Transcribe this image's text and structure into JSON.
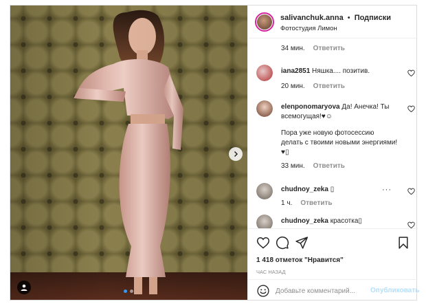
{
  "header": {
    "username": "salivanchuk.anna",
    "separator": "•",
    "follow_label": "Подписки",
    "location": "Фотостудия Лимон"
  },
  "comments": [
    {
      "meta_time": "34 мин.",
      "reply_label": "Ответить"
    },
    {
      "username": "iana2851",
      "text": "Няшка.... позитив.",
      "meta_time": "20 мин.",
      "reply_label": "Ответить"
    },
    {
      "username": "elenponomaryova",
      "text": "Да! Анечка! Ты всемогущая!♥☺",
      "text2": "Пора уже новую фотосессию делать с твоими новыми энергиями! ♥▯",
      "meta_time": "33 мин.",
      "reply_label": "Ответить"
    },
    {
      "username": "chudnoy_zeka",
      "text": "▯",
      "more": "···",
      "meta_time": "1 ч.",
      "reply_label": "Ответить"
    },
    {
      "username": "chudnoy_zeka",
      "text": "красотка▯"
    }
  ],
  "actions": {
    "likes": "1 418 отметок \"Нравится\"",
    "time_ago": "час назад",
    "comment_placeholder": "Добавьте комментарий...",
    "publish_label": "Опубликовать"
  },
  "colors": {
    "accent_blue": "#3897f0",
    "publish_disabled": "#b2dffc",
    "muted_text": "#8e8e8e",
    "border": "#dbdbdb"
  },
  "icons": [
    "chevron-right-icon",
    "user-tag-icon",
    "heart-icon",
    "comment-icon",
    "share-icon",
    "bookmark-icon",
    "emoji-icon",
    "more-icon"
  ]
}
